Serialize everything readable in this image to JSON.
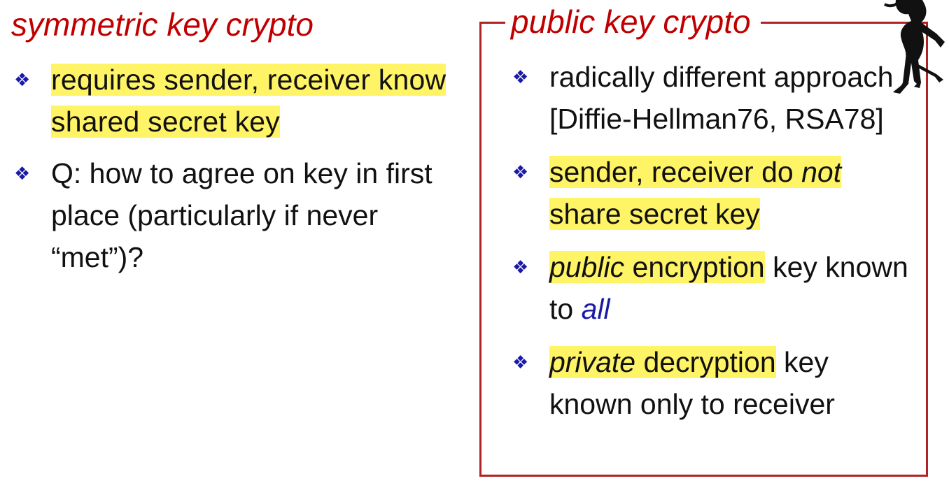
{
  "symmetric": {
    "title": "symmetric key crypto",
    "bullets": [
      {
        "text": "requires sender, receiver know shared secret key"
      },
      {
        "text": "Q: how to agree on key in first place (particularly if never “met”)?"
      }
    ]
  },
  "public": {
    "title": "public key crypto",
    "bullets": [
      {
        "text": "radically different approach [Diffie-Hellman76, RSA78]"
      },
      {
        "p1": "sender, receiver do ",
        "p2": "not",
        "p3": " share secret key"
      },
      {
        "p1": "public",
        "p2": " encryption",
        "p3": " key known to ",
        "p4": "all"
      },
      {
        "p1": "private",
        "p2": " decryption",
        "p3": " key known only to receiver"
      }
    ]
  },
  "bullet_glyph": "❖",
  "colors": {
    "title": "#c00000",
    "bullet": "#1a1aa6",
    "highlight": "#fff466",
    "box_border": "#b22222"
  },
  "icons": {
    "figure": "figure-cartoon-icon"
  }
}
